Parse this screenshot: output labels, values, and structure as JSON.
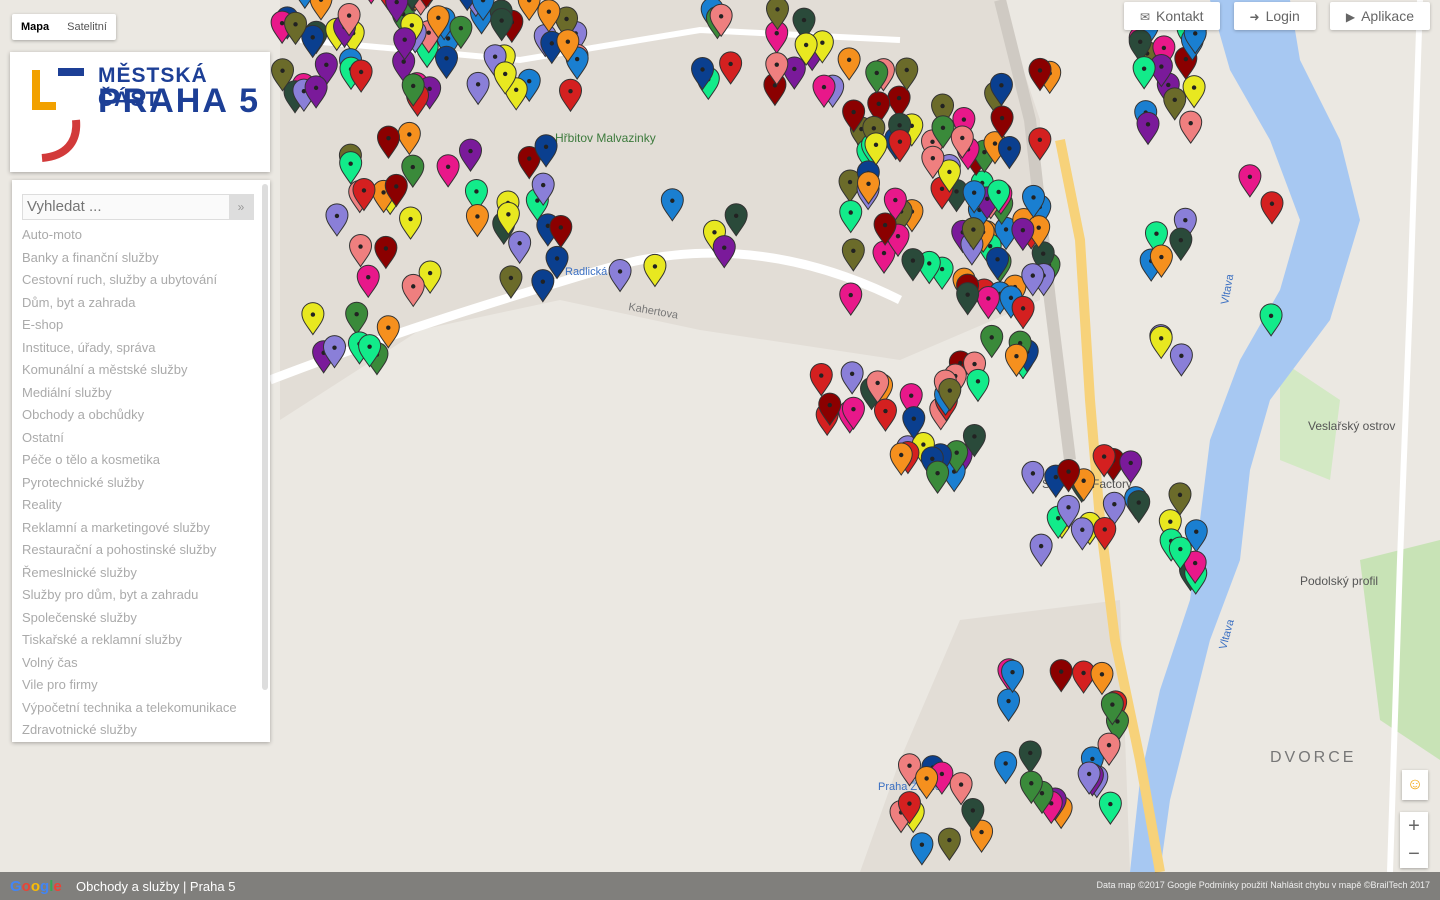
{
  "map_type": {
    "map": "Mapa",
    "satellite": "Satelitní"
  },
  "logo": {
    "line1": "MĚSTSKÁ ČÁST",
    "line2": "PRAHA 5"
  },
  "search": {
    "placeholder": "Vyhledat ...",
    "button": "»"
  },
  "categories": [
    "Auto-moto",
    "Banky a finanční služby",
    "Cestovní ruch, služby a ubytování",
    "Dům, byt a zahrada",
    "E-shop",
    "Instituce, úřady, správa",
    "Komunální a městské služby",
    "Mediální služby",
    "Obchody a obchůdky",
    "Ostatní",
    "Péče o tělo a kosmetika",
    "Pyrotechnické služby",
    "Reality",
    "Reklamní a marketingové služby",
    "Restaurační a pohostinské služby",
    "Řemeslnické služby",
    "Služby pro dům, byt a zahradu",
    "Společenské služby",
    "Tiskařské a reklamní služby",
    "Volný čas",
    "Vile pro firmy",
    "Výpočetní technika a telekomunikace",
    "Zdravotnické služby"
  ],
  "topnav": {
    "contact": "Kontakt",
    "login": "Login",
    "apps": "Aplikace"
  },
  "map_labels": {
    "cemetery": "Hřbitov Malvazinky",
    "station_radlicka": "Radlická",
    "street_kaplicka": "Kahertova",
    "district": "DVORCE",
    "vltava": "Vltava",
    "island": "Veslařský ostrov",
    "podolsky": "Podolský profil",
    "station_zlichov": "Praha Žvahov",
    "factory": "Smíchov Factory"
  },
  "footer": {
    "title": "Obchody a služby | Praha 5",
    "attribution": "Data map ©2017 Google  Podmínky použití  Nahlásit chybu v mapě  ©BrailTech 2017"
  },
  "colors": {
    "river": "#a7c8f2",
    "park": "#c8e3b6",
    "brand_blue": "#1d3f96",
    "brand_red": "#d23a3a",
    "brand_orange": "#f2a100"
  },
  "icons": {
    "zoom_in": "+",
    "zoom_out": "−",
    "pegman": "☺"
  }
}
